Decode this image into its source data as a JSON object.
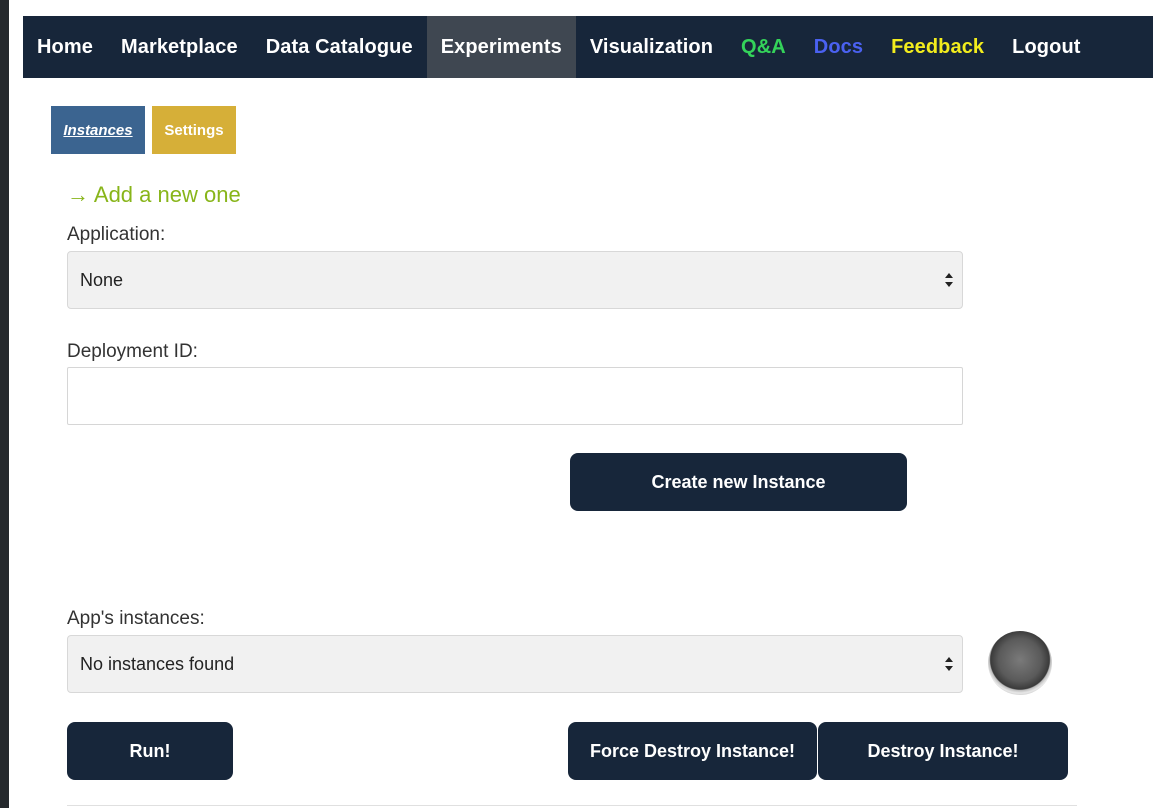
{
  "nav": {
    "items": [
      {
        "label": "Home"
      },
      {
        "label": "Marketplace"
      },
      {
        "label": "Data Catalogue"
      },
      {
        "label": "Experiments"
      },
      {
        "label": "Visualization"
      },
      {
        "label": "Q&A"
      },
      {
        "label": "Docs"
      },
      {
        "label": "Feedback"
      },
      {
        "label": "Logout"
      }
    ],
    "active": "Experiments",
    "colors": {
      "background": "#17263a",
      "active": "#3f4751",
      "qa": "#34d35a",
      "docs": "#4a61f0",
      "feedback": "#f2ec1d"
    }
  },
  "subtabs": {
    "instances": "Instances",
    "settings": "Settings",
    "colors": {
      "instances": "#3b6490",
      "settings": "#d6af38"
    }
  },
  "form": {
    "add_new": "→ Add a new one",
    "application_label": "Application:",
    "application_value": "None",
    "deployment_label": "Deployment ID:",
    "deployment_value": "",
    "create_button": "Create new Instance"
  },
  "instances": {
    "label": "App's instances:",
    "value": "No instances found",
    "status_icon": "status-light-off",
    "run_button": "Run!",
    "force_destroy_button": "Force Destroy Instance!",
    "destroy_button": "Destroy Instance!"
  },
  "accent": {
    "link_green": "#88b51a"
  }
}
